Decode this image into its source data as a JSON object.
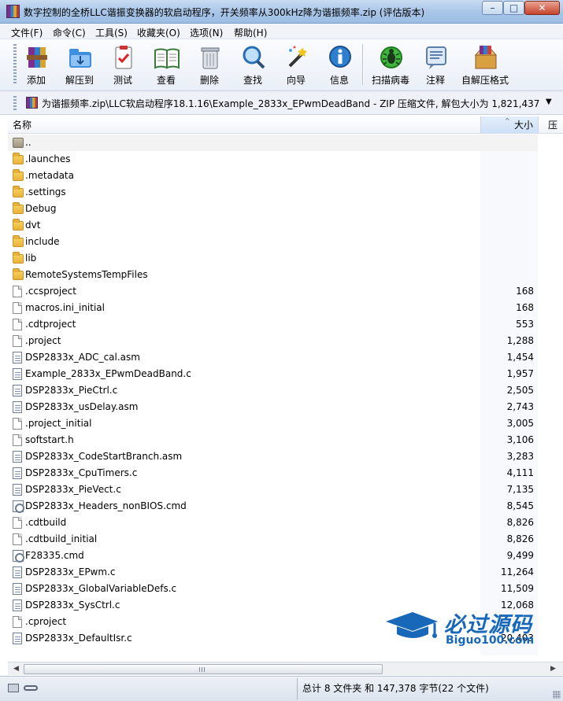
{
  "window": {
    "title": "数字控制的全桥LLC谐振变换器的软启动程序，开关频率从300kHz降为谐振频率.zip (评估版本)",
    "minimize": "–",
    "maximize": "□",
    "close": "✕"
  },
  "menu": [
    "文件(F)",
    "命令(C)",
    "工具(S)",
    "收藏夹(O)",
    "选项(N)",
    "帮助(H)"
  ],
  "toolbar": [
    {
      "label": "添加",
      "icon": "add-archive-icon"
    },
    {
      "label": "解压到",
      "icon": "extract-to-icon"
    },
    {
      "label": "测试",
      "icon": "test-icon"
    },
    {
      "label": "查看",
      "icon": "view-book-icon"
    },
    {
      "label": "删除",
      "icon": "delete-trash-icon"
    },
    {
      "label": "查找",
      "icon": "find-magnifier-icon"
    },
    {
      "label": "向导",
      "icon": "wizard-wand-icon"
    },
    {
      "label": "信息",
      "icon": "info-icon"
    },
    {
      "label": "扫描病毒",
      "icon": "scan-virus-icon"
    },
    {
      "label": "注释",
      "icon": "comment-icon"
    },
    {
      "label": "自解压格式",
      "icon": "sfx-box-icon"
    }
  ],
  "address": {
    "path": "为谐振频率.zip\\LLC软启动程序18.1.16\\Example_2833x_EPwmDeadBand - ZIP 压缩文件, 解包大小为 1,821,437 字节"
  },
  "columns": {
    "name": "名称",
    "size": "大小",
    "extra": "压"
  },
  "files": [
    {
      "name": "..",
      "size": "",
      "type": "up"
    },
    {
      "name": ".launches",
      "size": "",
      "type": "folder"
    },
    {
      "name": ".metadata",
      "size": "",
      "type": "folder"
    },
    {
      "name": ".settings",
      "size": "",
      "type": "folder"
    },
    {
      "name": "Debug",
      "size": "",
      "type": "folder"
    },
    {
      "name": "dvt",
      "size": "",
      "type": "folder"
    },
    {
      "name": "include",
      "size": "",
      "type": "folder"
    },
    {
      "name": "lib",
      "size": "",
      "type": "folder"
    },
    {
      "name": "RemoteSystemsTempFiles",
      "size": "",
      "type": "folder"
    },
    {
      "name": ".ccsproject",
      "size": "168",
      "type": "file"
    },
    {
      "name": "macros.ini_initial",
      "size": "168",
      "type": "file"
    },
    {
      "name": ".cdtproject",
      "size": "553",
      "type": "file"
    },
    {
      "name": ".project",
      "size": "1,288",
      "type": "file"
    },
    {
      "name": "DSP2833x_ADC_cal.asm",
      "size": "1,454",
      "type": "code"
    },
    {
      "name": "Example_2833x_EPwmDeadBand.c",
      "size": "1,957",
      "type": "code"
    },
    {
      "name": "DSP2833x_PieCtrl.c",
      "size": "2,505",
      "type": "code"
    },
    {
      "name": "DSP2833x_usDelay.asm",
      "size": "2,743",
      "type": "code"
    },
    {
      "name": ".project_initial",
      "size": "3,005",
      "type": "file"
    },
    {
      "name": "softstart.h",
      "size": "3,106",
      "type": "file"
    },
    {
      "name": "DSP2833x_CodeStartBranch.asm",
      "size": "3,283",
      "type": "code"
    },
    {
      "name": "DSP2833x_CpuTimers.c",
      "size": "4,111",
      "type": "code"
    },
    {
      "name": "DSP2833x_PieVect.c",
      "size": "7,135",
      "type": "code"
    },
    {
      "name": "DSP2833x_Headers_nonBIOS.cmd",
      "size": "8,545",
      "type": "cmd"
    },
    {
      "name": ".cdtbuild",
      "size": "8,826",
      "type": "file"
    },
    {
      "name": ".cdtbuild_initial",
      "size": "8,826",
      "type": "file"
    },
    {
      "name": "F28335.cmd",
      "size": "9,499",
      "type": "cmd"
    },
    {
      "name": "DSP2833x_EPwm.c",
      "size": "11,264",
      "type": "code"
    },
    {
      "name": "DSP2833x_GlobalVariableDefs.c",
      "size": "11,509",
      "type": "code"
    },
    {
      "name": "DSP2833x_SysCtrl.c",
      "size": "12,068",
      "type": "code"
    },
    {
      "name": ".cproject",
      "size": "",
      "type": "file"
    },
    {
      "name": "DSP2833x_DefaultIsr.c",
      "size": "20,403",
      "type": "code"
    }
  ],
  "status": {
    "text": "总计 8 文件夹 和 147,378 字节(22 个文件)"
  },
  "watermark": {
    "cn": "必过源码",
    "en": "Biguo100.com"
  }
}
